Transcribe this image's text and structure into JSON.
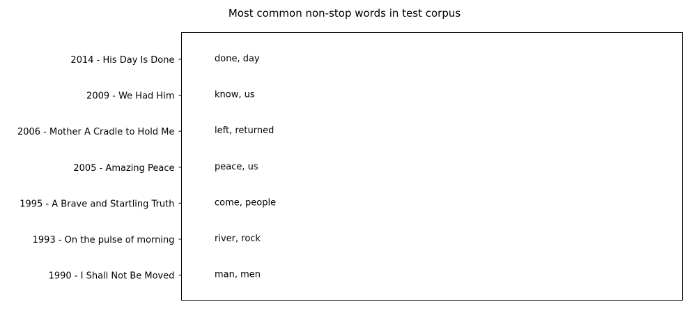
{
  "chart_data": {
    "type": "table",
    "title": "Most common non-stop words in test corpus",
    "xlabel": "",
    "ylabel": "",
    "grid": false,
    "legend": "none",
    "rows": [
      {
        "label": "2014 - His Day Is Done",
        "words": "done, day"
      },
      {
        "label": "2009 - We Had Him",
        "words": "know, us"
      },
      {
        "label": "2006 - Mother A Cradle to Hold Me",
        "words": "left, returned"
      },
      {
        "label": "2005 - Amazing Peace",
        "words": "peace, us"
      },
      {
        "label": "1995 - A Brave and Startling Truth",
        "words": "come, people"
      },
      {
        "label": "1993 - On the pulse of morning",
        "words": "river, rock"
      },
      {
        "label": "1990 - I Shall Not Be Moved",
        "words": "man, men"
      }
    ]
  }
}
